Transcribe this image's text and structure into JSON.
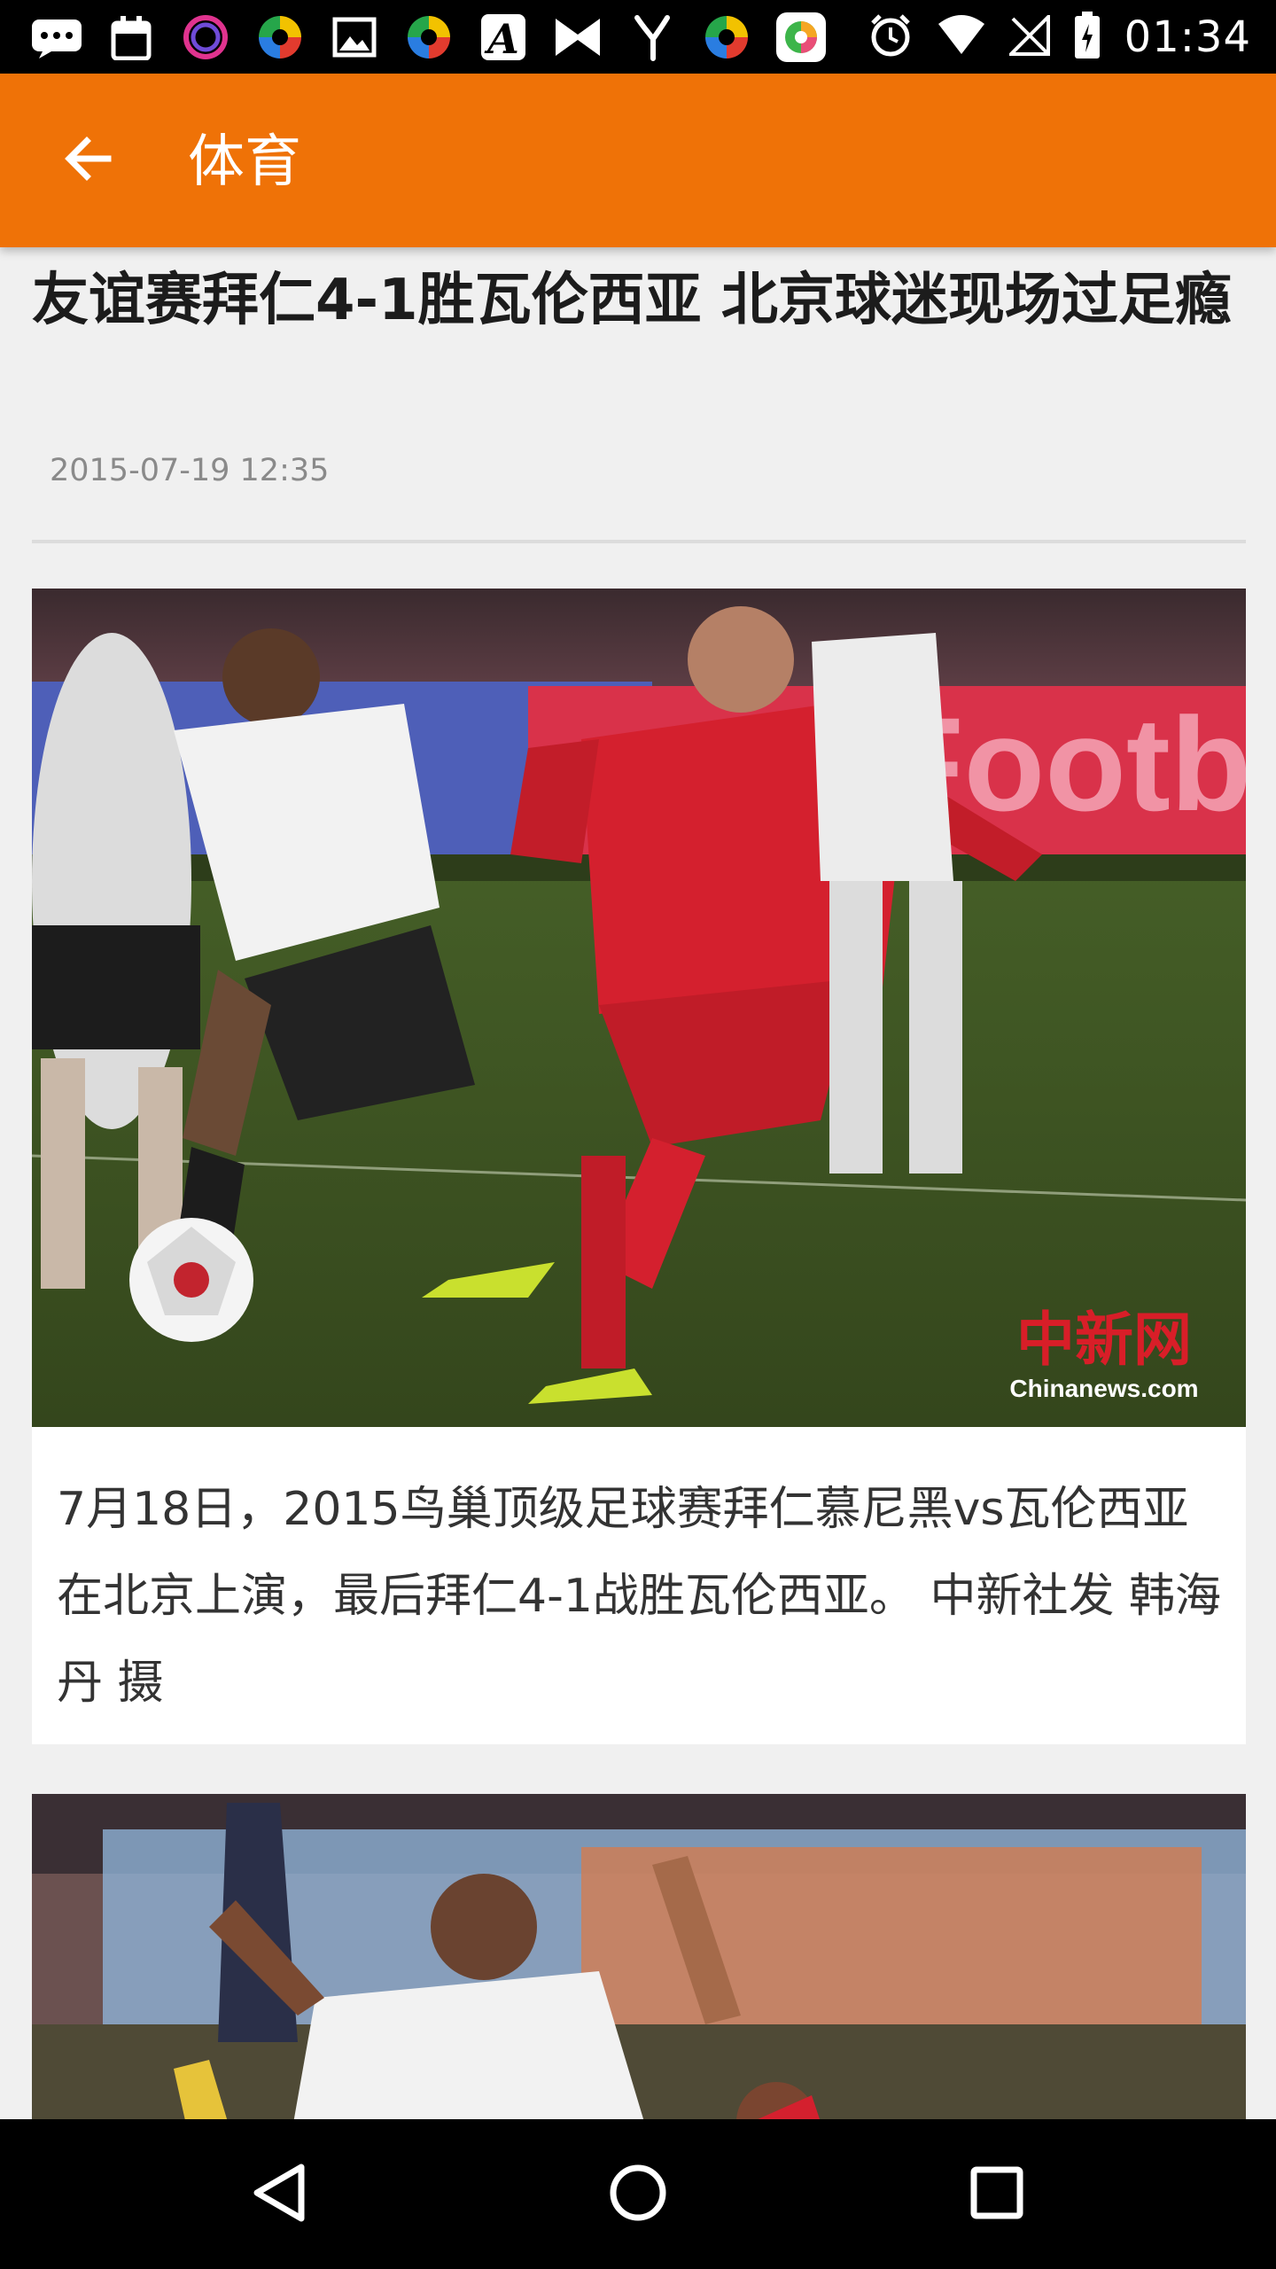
{
  "status_bar": {
    "time": "01:34",
    "notification_icons": [
      "message-icon",
      "calendar-icon",
      "app-ring-icon",
      "app-colorball-icon",
      "image-icon",
      "app-colorball-icon",
      "app-a-icon",
      "app-bow-icon",
      "app-y-icon",
      "app-colorball-icon",
      "app-browser-icon"
    ],
    "system_icons": [
      "alarm-icon",
      "wifi-icon",
      "no-signal-icon",
      "battery-icon"
    ]
  },
  "app_bar": {
    "title": "体育",
    "back_icon": "arrow-back-icon",
    "color": "#ef7207"
  },
  "article": {
    "headline": "友谊赛拜仁4-1胜瓦伦西亚 北京球迷现场过足瘾",
    "timestamp": "2015-07-19 12:35",
    "photos": [
      {
        "caption": "7月18日，2015鸟巢顶级足球赛拜仁慕尼黑vs瓦伦西亚在北京上演，最后拜仁4-1战胜瓦伦西亚。 中新社发 韩海丹 摄",
        "watermark": "中新网",
        "watermark_sub": "Chinanews.com",
        "board_text": "Footbal"
      },
      {
        "caption": ""
      }
    ]
  },
  "nav_bar": {
    "buttons": [
      "back-triangle-icon",
      "home-circle-icon",
      "recents-square-icon"
    ]
  }
}
